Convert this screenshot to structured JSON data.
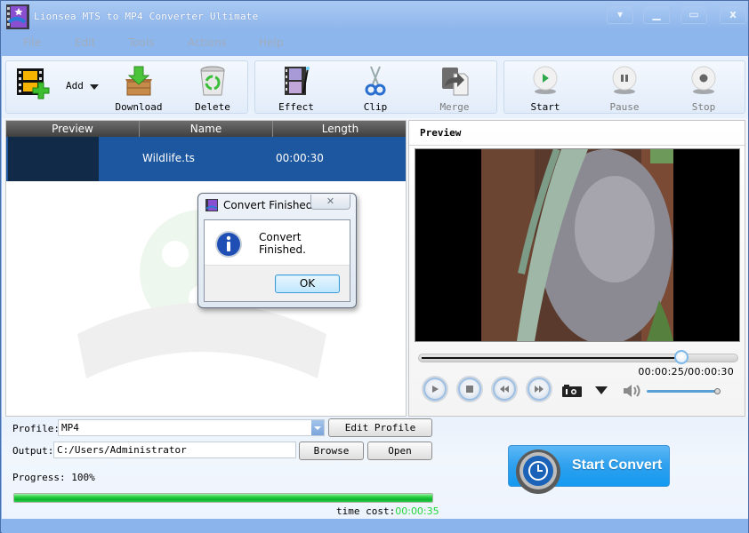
{
  "window": {
    "title": "Lionsea MTS to MP4 Converter Ultimate",
    "controls": {
      "menu": "▾",
      "minimize": "▁",
      "maximize": "▭",
      "close": "x"
    }
  },
  "menubar": {
    "items": [
      {
        "label": "File"
      },
      {
        "label": "Edit"
      },
      {
        "label": "Tools"
      },
      {
        "label": "Actions"
      },
      {
        "label": "Help"
      }
    ]
  },
  "toolbar": {
    "add": {
      "label": "Add",
      "icon": "add-video-icon"
    },
    "download": {
      "label": "Download",
      "icon": "download-box-icon"
    },
    "delete": {
      "label": "Delete",
      "icon": "recycle-bin-icon"
    },
    "effect": {
      "label": "Effect",
      "icon": "film-effect-icon"
    },
    "clip": {
      "label": "Clip",
      "icon": "scissors-icon"
    },
    "merge": {
      "label": "Merge",
      "icon": "merge-icon",
      "disabled": true
    },
    "start": {
      "label": "Start",
      "icon": "play-icon"
    },
    "pause": {
      "label": "Pause",
      "icon": "pause-icon",
      "disabled": true
    },
    "stop": {
      "label": "Stop",
      "icon": "stop-icon",
      "disabled": true
    }
  },
  "file_list": {
    "columns": [
      "Preview",
      "Name",
      "Length"
    ],
    "rows": [
      {
        "name": "Wildlife.ts",
        "length": "00:00:30",
        "selected": true
      }
    ]
  },
  "preview": {
    "title": "Preview",
    "position": "00:00:25",
    "duration": "00:00:30",
    "time_readout": "00:00:25/00:00:30",
    "seek_fraction": 0.833,
    "volume_fraction": 1.0
  },
  "dialog": {
    "title": "Convert Finished",
    "message": "Convert Finished.",
    "ok_label": "OK",
    "close_label": "✕"
  },
  "settings": {
    "profile_label": "Profile:",
    "profile_value": "MP4",
    "edit_profile_label": "Edit Profile",
    "output_label": "Output:",
    "output_value": "C:/Users/Administrator",
    "browse_label": "Browse",
    "open_label": "Open",
    "progress_label": "Progress: 100%",
    "progress_percent": 100,
    "time_cost_label": "time cost:",
    "time_cost_value": "00:00:35"
  },
  "start_convert": {
    "label": "Start Convert"
  },
  "colors": {
    "accent": "#1c57a0",
    "progress_green": "#0ab52a",
    "time_cost_green": "#22d63a",
    "start_convert_blue": "#2ea0ee"
  }
}
